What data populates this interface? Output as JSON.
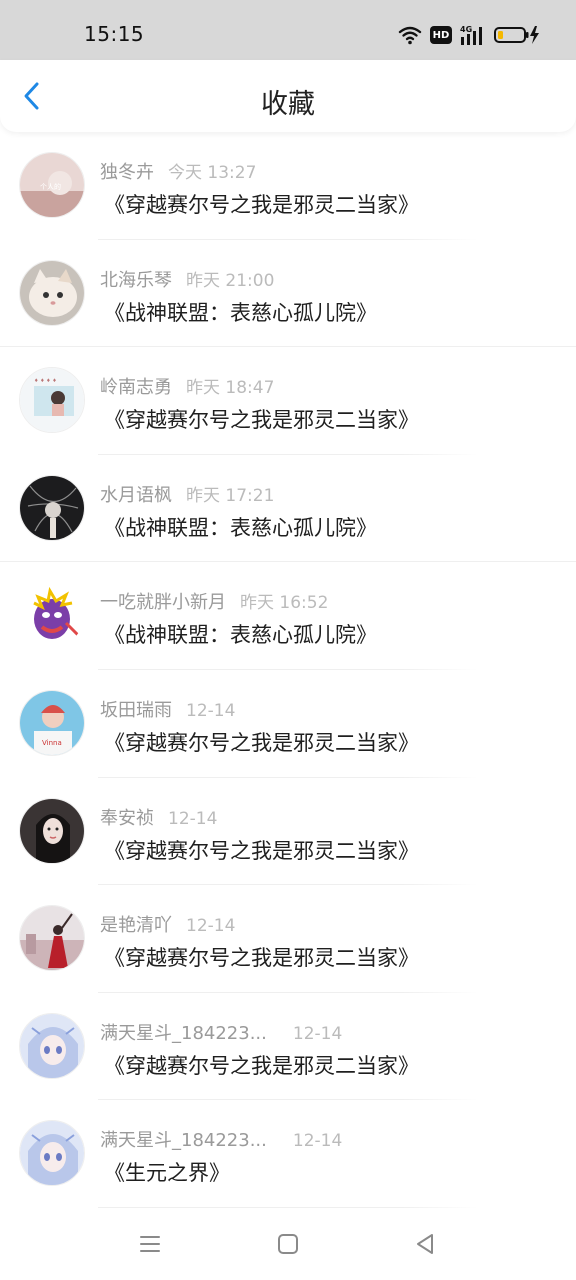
{
  "status_bar": {
    "time": "15:15",
    "hd_label": "HD",
    "network_label": "4G"
  },
  "header": {
    "title": "收藏"
  },
  "colors": {
    "accent": "#1e88e5",
    "status_bar_bg": "#d8d8d8"
  },
  "favorites": [
    {
      "name": "独冬卉",
      "time": "今天 13:27",
      "book": "《穿越赛尔号之我是邪灵二当家》",
      "avatar": "avatar-icon"
    },
    {
      "name": "北海乐琴",
      "time": "昨天 21:00",
      "book": "《战神联盟：表慈心孤儿院》",
      "avatar": "cat-avatar-icon"
    },
    {
      "name": "岭南志勇",
      "time": "昨天 18:47",
      "book": "《穿越赛尔号之我是邪灵二当家》",
      "avatar": "girl-avatar-icon"
    },
    {
      "name": "水月语枫",
      "time": "昨天 17:21",
      "book": "《战神联盟：表慈心孤儿院》",
      "avatar": "dark-avatar-icon"
    },
    {
      "name": "一吃就胖小新月",
      "time": "昨天 16:52",
      "book": "《战神联盟：表慈心孤儿院》",
      "avatar": "cartoon-avatar-icon"
    },
    {
      "name": "坂田瑞雨",
      "time": "12-14",
      "book": "《穿越赛尔号之我是邪灵二当家》",
      "avatar": "boy-avatar-icon"
    },
    {
      "name": "奉安祯",
      "time": "12-14",
      "book": "《穿越赛尔号之我是邪灵二当家》",
      "avatar": "woman-avatar-icon"
    },
    {
      "name": "是艳清吖",
      "time": "12-14",
      "book": "《穿越赛尔号之我是邪灵二当家》",
      "avatar": "red-dress-avatar-icon"
    },
    {
      "name": "满天星斗_184223...",
      "time": "12-14",
      "book": "《穿越赛尔号之我是邪灵二当家》",
      "avatar": "anime-avatar-icon"
    },
    {
      "name": "满天星斗_184223...",
      "time": "12-14",
      "book": "《生元之界》",
      "avatar": "anime-avatar-icon"
    }
  ],
  "nav_bar": {
    "menu": "menu-icon",
    "home": "home-icon",
    "back": "back-triangle-icon"
  }
}
